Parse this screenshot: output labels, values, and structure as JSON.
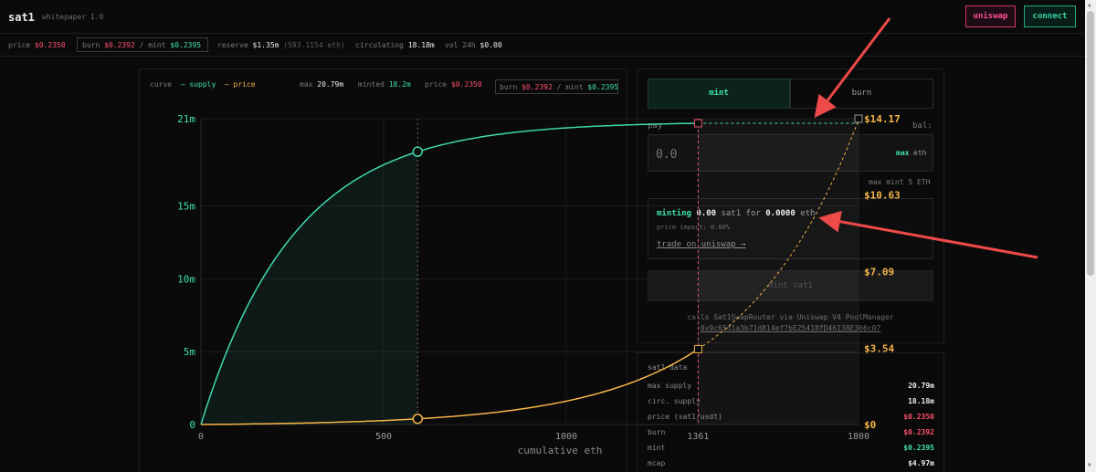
{
  "header": {
    "brand": "sat1",
    "whitepaper": "whitepaper 1.0",
    "uniswap_label": "uniswap",
    "connect_label": "connect"
  },
  "stats": {
    "price_label": "price",
    "price_value": "$0.2350",
    "burn_label": "burn",
    "burn_value": "$0.2392",
    "sep": "/",
    "mint_label": "mint",
    "mint_value": "$0.2395",
    "reserve_label": "reserve",
    "reserve_value": "$1.35m",
    "reserve_eth": "(593.1154 eth)",
    "circulating_label": "circulating",
    "circulating_value": "18.18m",
    "vol_label": "vol 24h",
    "vol_value": "$0.00"
  },
  "chart_legend": {
    "curve": "curve",
    "supply": "— supply",
    "price": "— price",
    "max_label": "max",
    "max_value": "20.79m",
    "minted_label": "minted",
    "minted_value": "18.2m",
    "price_label": "price",
    "price_value": "$0.2350",
    "burn_label": "burn",
    "burn_value": "$0.2392",
    "sep": "/",
    "mint_label": "mint",
    "mint_value": "$0.2395"
  },
  "chart_data": {
    "type": "line",
    "xlabel": "cumulative eth",
    "xlim": [
      0,
      1800
    ],
    "x_ticks": [
      0,
      500,
      1000,
      1361,
      1800
    ],
    "x_tick_labels": [
      "0",
      "500",
      "1000",
      "1361",
      "1800"
    ],
    "y_left_ticks": [
      "0",
      "5m",
      "10m",
      "15m",
      "21m"
    ],
    "y_left_values": [
      0,
      5000000,
      10000000,
      15000000,
      21000000
    ],
    "y_right_ticks": [
      "$0",
      "$3.54",
      "$7.09",
      "$10.63",
      "$14.17"
    ],
    "y_right_values": [
      0,
      3.54,
      7.09,
      10.63,
      14.17
    ],
    "current_eth": 593.1154,
    "max_eth": 1361,
    "series": [
      {
        "name": "supply",
        "color": "#3fd8ad",
        "max": 20790000,
        "k": 0.0039
      },
      {
        "name": "price",
        "color": "#f5b54a",
        "end_price": 3.54,
        "curve_end_price": 14.17
      }
    ],
    "grid": true
  },
  "mint_panel": {
    "tab_mint": "mint",
    "tab_burn": "burn",
    "pay_label": "pay",
    "bal_label": "bal:",
    "pay_placeholder": "0.0",
    "max_label": "max",
    "eth_unit": "eth",
    "max_mint": "max mint 5 ETH",
    "minting": "minting",
    "mint_amount": "0.00",
    "mint_unit": "sat1 for",
    "eth_amount": "0.0000",
    "eth_unit2": "eth",
    "price_impact": "price impact: 0.00%",
    "trade_link": "trade on uniswap →",
    "submit_label": "mint sat1",
    "calls_label": "calls Sat1SwapRouter via Uniswap V4 PoolManager",
    "calls_address": "0x9c65d1a3b71d814ef7bE25418fD46138E366c07"
  },
  "data_panel": {
    "title": "sat1 data",
    "rows": [
      {
        "k": "max supply",
        "v": "20.79m",
        "color": "#ececec"
      },
      {
        "k": "circ. supply",
        "v": "18.18m",
        "color": "#ececec"
      },
      {
        "k": "price (sat1/usdt)",
        "v": "$0.2350",
        "color": "#ff4f6e"
      },
      {
        "k": "burn",
        "v": "$0.2392",
        "color": "#ff4f6e"
      },
      {
        "k": "mint",
        "v": "$0.2395",
        "color": "#3ee0b0"
      },
      {
        "k": "mcap",
        "v": "$4.97m",
        "color": "#ececec"
      }
    ]
  },
  "colors": {
    "accent": "#3ee0b0",
    "red": "#ff4f6e",
    "orange": "#f5b54a",
    "annotation": "#ee4a4a"
  }
}
